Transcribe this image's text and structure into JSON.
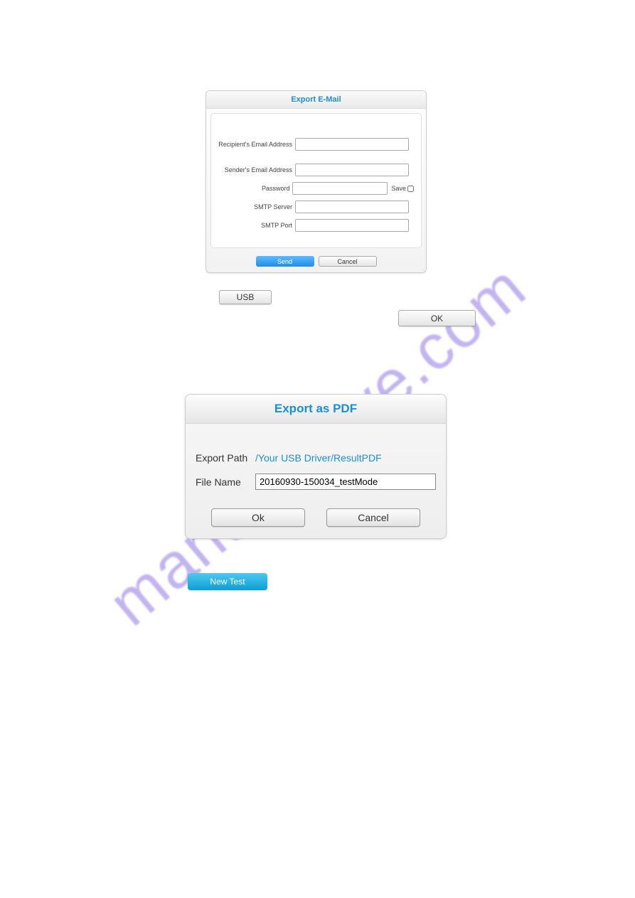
{
  "watermark": "manualshive.com",
  "email_dialog": {
    "title": "Export E-Mail",
    "recipient_label": "Recipient's Email Address",
    "recipient_value": "",
    "sender_label": "Sender's Email Address",
    "sender_value": "",
    "password_label": "Password",
    "password_value": "",
    "save_label": "Save",
    "save_checked": false,
    "smtp_server_label": "SMTP Server",
    "smtp_server_value": "",
    "smtp_port_label": "SMTP Port",
    "smtp_port_value": "",
    "send_label": "Send",
    "cancel_label": "Cancel"
  },
  "usb_button_label": "USB",
  "ok_top_label": "OK",
  "pdf_dialog": {
    "title": "Export as PDF",
    "path_label": "Export Path",
    "path_value": "/Your USB Driver/ResultPDF",
    "filename_label": "File Name",
    "filename_value": "20160930-150034_testMode",
    "ok_label": "Ok",
    "cancel_label": "Cancel"
  },
  "new_test_label": "New Test"
}
